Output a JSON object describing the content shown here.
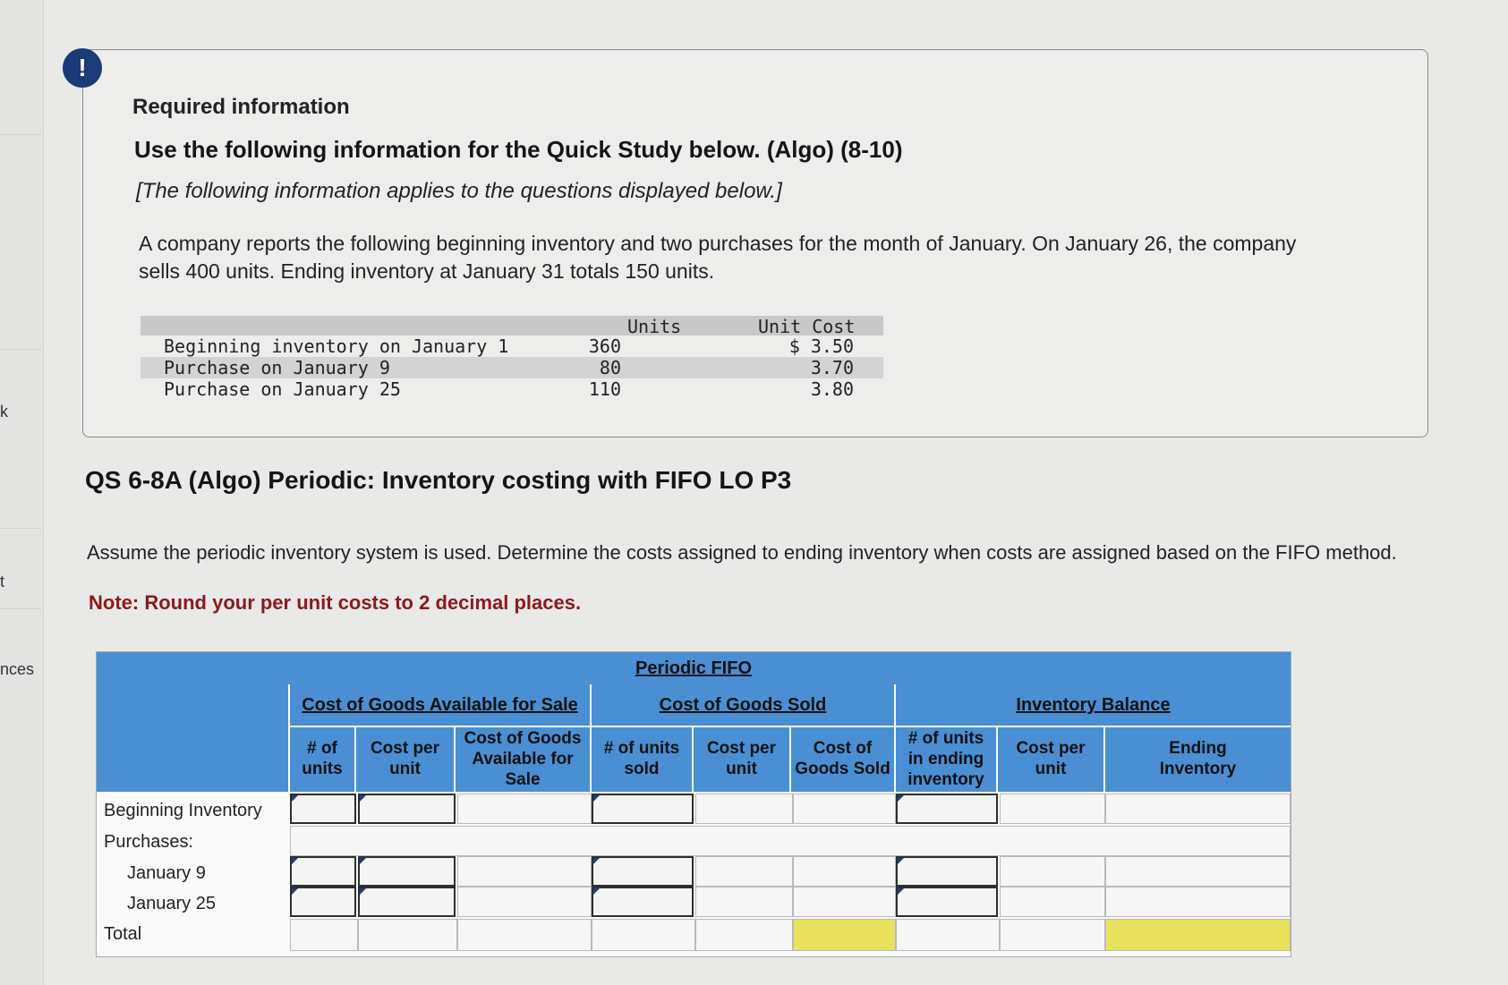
{
  "sidebar": {
    "labels": [
      "k",
      "t",
      "nces"
    ]
  },
  "info": {
    "alert_icon": "!",
    "required": "Required information",
    "title": "Use the following information for the Quick Study below. (Algo) (8-10)",
    "applies": "[The following information applies to the questions displayed below.]",
    "paragraph": "A company reports the following beginning inventory and two purchases for the month of January. On January 26, the company sells 400 units. Ending inventory at January 31 totals 150 units.",
    "table": {
      "headers": {
        "units": "Units",
        "unit_cost": "Unit Cost"
      },
      "rows": [
        {
          "label": "Beginning inventory on January 1",
          "units": "360",
          "cost": "$ 3.50"
        },
        {
          "label": "Purchase on January 9",
          "units": "80",
          "cost": "3.70"
        },
        {
          "label": "Purchase on January 25",
          "units": "110",
          "cost": "3.80"
        }
      ]
    }
  },
  "question": {
    "title": "QS 6-8A (Algo) Periodic: Inventory costing with FIFO LO P3",
    "instructions": "Assume the periodic inventory system is used. Determine the costs assigned to ending inventory when costs are assigned based on the FIFO method.",
    "note": "Note: Round your per unit costs to 2 decimal places."
  },
  "fifo": {
    "title": "Periodic FIFO",
    "groups": {
      "available": "Cost of Goods Available for Sale",
      "sold": "Cost of Goods Sold",
      "balance": "Inventory Balance"
    },
    "columns": {
      "avail_units": [
        "# of",
        "units"
      ],
      "avail_cost": [
        "Cost per",
        "unit"
      ],
      "avail_total": [
        "Cost of Goods",
        "Available for",
        "Sale"
      ],
      "sold_units": [
        "# of units",
        "sold"
      ],
      "sold_cost": [
        "Cost per",
        "unit"
      ],
      "sold_total": [
        "Cost of",
        "Goods Sold"
      ],
      "end_units": [
        "# of units",
        "in ending",
        "inventory"
      ],
      "end_cost": [
        "Cost per",
        "unit"
      ],
      "end_total": [
        "Ending",
        "Inventory"
      ]
    },
    "row_labels": {
      "beginning": "Beginning Inventory",
      "purchases": "Purchases:",
      "jan9": "January 9",
      "jan25": "January 25",
      "total": "Total"
    },
    "colors": {
      "header": "#4a8fd4",
      "highlight": "#e8e25c"
    }
  }
}
